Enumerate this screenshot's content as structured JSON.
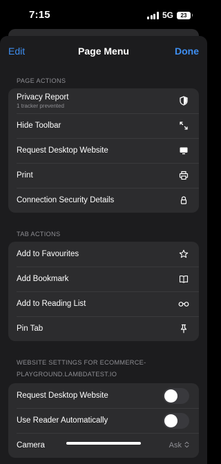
{
  "status_bar": {
    "time": "7:15",
    "network": "5G",
    "battery": "23"
  },
  "nav": {
    "edit_label": "Edit",
    "title": "Page Menu",
    "done_label": "Done"
  },
  "page_actions": {
    "header": "PAGE ACTIONS",
    "items": [
      {
        "label": "Privacy Report",
        "sublabel": "1 tracker prevented",
        "icon": "shield-icon"
      },
      {
        "label": "Hide Toolbar",
        "icon": "resize-arrows-icon"
      },
      {
        "label": "Request Desktop Website",
        "icon": "desktop-icon"
      },
      {
        "label": "Print",
        "icon": "printer-icon"
      },
      {
        "label": "Connection Security Details",
        "icon": "lock-icon"
      }
    ]
  },
  "tab_actions": {
    "header": "TAB ACTIONS",
    "items": [
      {
        "label": "Add to Favourites",
        "icon": "star-icon"
      },
      {
        "label": "Add Bookmark",
        "icon": "book-icon"
      },
      {
        "label": "Add to Reading List",
        "icon": "glasses-icon"
      },
      {
        "label": "Pin Tab",
        "icon": "pin-icon"
      }
    ]
  },
  "website_settings": {
    "header": "WEBSITE SETTINGS FOR ECOMMERCE-PLAYGROUND.LAMBDATEST.IO",
    "header_line1": "WEBSITE SETTINGS FOR ECOMMERCE-",
    "header_line2": "PLAYGROUND.LAMBDATEST.IO",
    "items": [
      {
        "label": "Request Desktop Website",
        "toggle": false
      },
      {
        "label": "Use Reader Automatically",
        "toggle": false
      },
      {
        "label": "Camera",
        "value": "Ask"
      }
    ]
  }
}
